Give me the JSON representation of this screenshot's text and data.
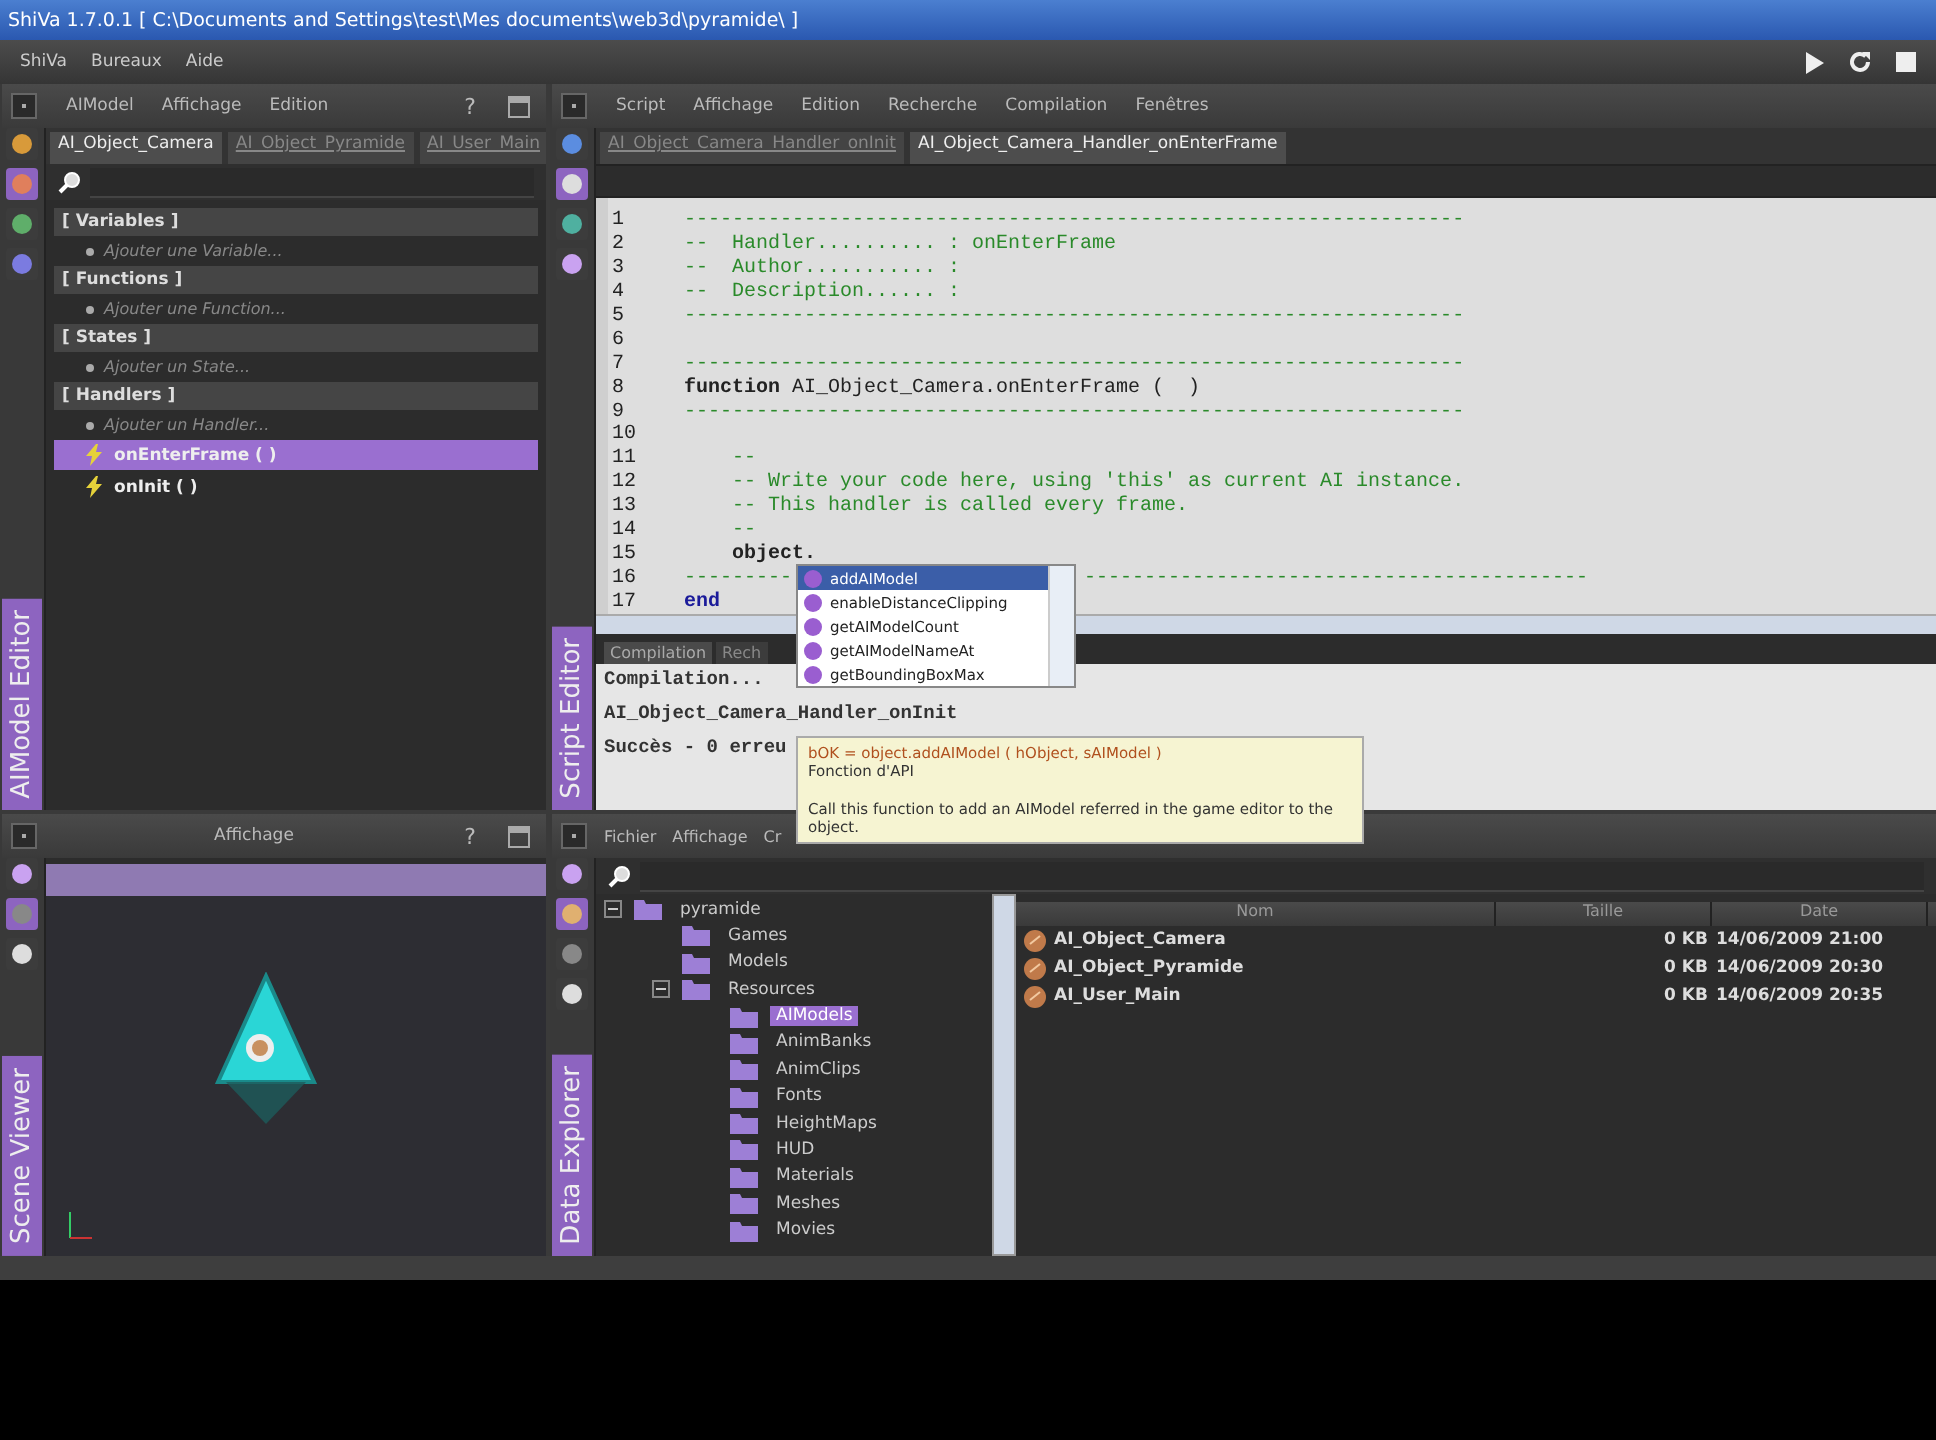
{
  "window": {
    "title": "ShiVa 1.7.0.1 [ C:\\Documents and Settings\\test\\Mes documents\\web3d\\pyramide\\ ]"
  },
  "menu_bar": [
    "ShiVa",
    "Bureaux",
    "Aide"
  ],
  "aimodel_editor": {
    "label": "AIModel Editor",
    "menus": [
      "AIModel",
      "Affichage",
      "Edition"
    ],
    "help": "?",
    "tabs": [
      {
        "label": "AI_Object_Camera",
        "selected": true
      },
      {
        "label": "AI_Object_Pyramide",
        "selected": false
      },
      {
        "label": "AI_User_Main",
        "selected": false
      }
    ],
    "sections": [
      {
        "title": "[ Variables ]",
        "add_label": "Ajouter une Variable..."
      },
      {
        "title": "[ Functions ]",
        "add_label": "Ajouter une Function..."
      },
      {
        "title": "[ States ]",
        "add_label": "Ajouter un State..."
      },
      {
        "title": "[ Handlers ]",
        "add_label": "Ajouter un Handler...",
        "items": [
          {
            "label": "onEnterFrame ( )",
            "selected": true
          },
          {
            "label": "onInit ( )",
            "selected": false
          }
        ]
      }
    ]
  },
  "script_editor": {
    "label": "Script Editor",
    "menus": [
      "Script",
      "Affichage",
      "Edition",
      "Recherche",
      "Compilation",
      "Fenêtres"
    ],
    "tabs": [
      {
        "label": "AI_Object_Camera_Handler_onInit",
        "selected": false
      },
      {
        "label": "AI_Object_Camera_Handler_onEnterFrame",
        "selected": true
      }
    ],
    "code_lines": [
      {
        "number": "1",
        "kind": "comment",
        "text": "-----------------------------------------------------------------"
      },
      {
        "number": "2",
        "kind": "comment",
        "text": "--  Handler.......... : onEnterFrame"
      },
      {
        "number": "3",
        "kind": "comment",
        "text": "--  Author........... :"
      },
      {
        "number": "4",
        "kind": "comment",
        "text": "--  Description...... :"
      },
      {
        "number": "5",
        "kind": "comment",
        "text": "-----------------------------------------------------------------"
      },
      {
        "number": "6"
      },
      {
        "number": "7",
        "kind": "comment",
        "text": "-----------------------------------------------------------------"
      },
      {
        "number": "8",
        "kind": "code",
        "text": "**function** AI_Object_Camera.onEnterFrame (  )"
      },
      {
        "number": "9",
        "kind": "comment",
        "text": "-----------------------------------------------------------------"
      },
      {
        "number": "10"
      },
      {
        "number": "11",
        "kind": "comment",
        "text": "    --"
      },
      {
        "number": "12",
        "kind": "comment",
        "text": "    -- Write your code here, using 'this' as current AI instance."
      },
      {
        "number": "13",
        "kind": "comment",
        "text": "    -- This handler is called every frame."
      },
      {
        "number": "14",
        "kind": "comment",
        "text": "    --"
      },
      {
        "number": "15",
        "kind": "code",
        "text": "    **object.**"
      },
      {
        "number": "16",
        "kind": "comment",
        "text": "---------",
        "continuation": "------------------------------------------"
      },
      {
        "number": "17",
        "kind": "keyword",
        "text": "end"
      }
    ],
    "autocomplete": [
      {
        "label": "addAIModel",
        "selected": true
      },
      {
        "label": "enableDistanceClipping",
        "selected": false
      },
      {
        "label": "getAIModelCount",
        "selected": false
      },
      {
        "label": "getAIModelNameAt",
        "selected": false
      },
      {
        "label": "getBoundingBoxMax",
        "selected": false
      }
    ],
    "output_tabs": [
      {
        "label": "Compilation",
        "selected": true
      },
      {
        "label": "Rech",
        "selected": false
      }
    ],
    "output_lines": [
      "Compilation...",
      "AI_Object_Camera_Handler_onInit",
      "Succès - 0 erreu"
    ],
    "tooltip": {
      "signature": "bOK = object.addAIModel ( hObject, sAIModel )",
      "subtitle": "Fonction d'API",
      "description": "Call this function to add an AIModel referred in the game editor to the object."
    }
  },
  "scene_viewer": {
    "label": "Scene Viewer",
    "menus": [
      "Affichage"
    ],
    "help": "?"
  },
  "data_explorer": {
    "label": "Data Explorer",
    "menus": [
      "Fichier",
      "Affichage",
      "Cr"
    ],
    "tree": [
      {
        "label": "pyramide",
        "expanded": true,
        "selected": false,
        "children": [
          {
            "label": "Games",
            "selected": false
          },
          {
            "label": "Models",
            "selected": false
          },
          {
            "label": "Resources",
            "expanded": true,
            "selected": false,
            "children": [
              {
                "label": "AIModels",
                "selected": true
              },
              {
                "label": "AnimBanks",
                "selected": false
              },
              {
                "label": "AnimClips",
                "selected": false
              },
              {
                "label": "Fonts",
                "selected": false
              },
              {
                "label": "HeightMaps",
                "selected": false
              },
              {
                "label": "HUD",
                "selected": false
              },
              {
                "label": "Materials",
                "selected": false
              },
              {
                "label": "Meshes",
                "selected": false
              },
              {
                "label": "Movies",
                "selected": false
              }
            ]
          }
        ]
      }
    ],
    "table": {
      "columns": [
        "Nom",
        "Taille",
        "Date"
      ],
      "rows": [
        {
          "name": "AI_Object_Camera",
          "size": "0 KB",
          "date": "14/06/2009 21:00"
        },
        {
          "name": "AI_Object_Pyramide",
          "size": "0 KB",
          "date": "14/06/2009 20:30"
        },
        {
          "name": "AI_User_Main",
          "size": "0 KB",
          "date": "14/06/2009 20:35"
        }
      ]
    }
  }
}
